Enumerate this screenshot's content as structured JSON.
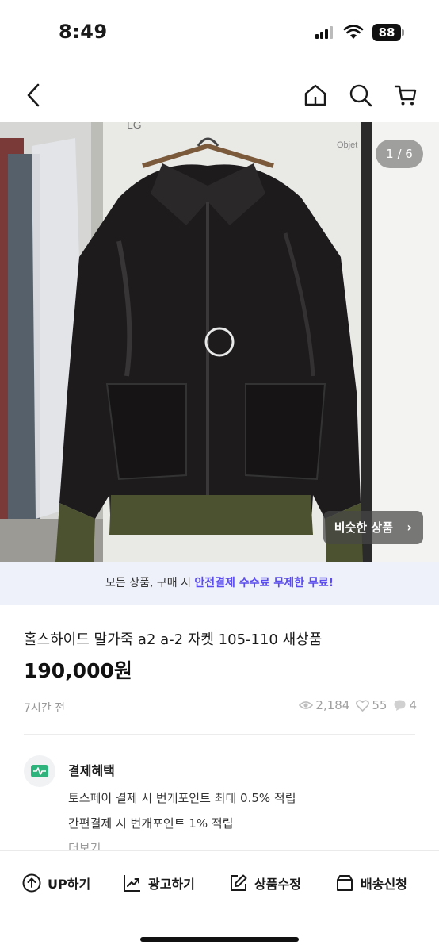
{
  "status_bar": {
    "time": "8:49",
    "battery": "88"
  },
  "top_nav": {
    "icons": [
      "back-chevron-icon",
      "home-icon",
      "search-icon",
      "cart-icon"
    ]
  },
  "image": {
    "counter": "1 / 6",
    "similar_label": "비슷한 상품",
    "similar_chevron": "›",
    "brand_mark": "LG",
    "tag_text": "Objet"
  },
  "promo": {
    "prefix": "모든 상품, 구매 시 ",
    "highlight": "안전결제 수수료 무제한 무료!",
    "highlight_color": "#5b4cf0"
  },
  "product": {
    "title": "홀스하이드 말가죽 a2 a-2 자켓 105-110 새상품",
    "price": "190,000원",
    "posted": "7시간 전",
    "views": "2,184",
    "likes": "55",
    "chats": "4"
  },
  "benefits": {
    "title": "결제혜택",
    "lines": [
      "토스페이 결제 시 번개포인트 최대 0.5% 적립",
      "간편결제 시 번개포인트 1% 적립"
    ],
    "more": "더보기"
  },
  "toolbar": {
    "up": "UP하기",
    "ad": "광고하기",
    "edit": "상품수정",
    "shipping": "배송신청"
  }
}
